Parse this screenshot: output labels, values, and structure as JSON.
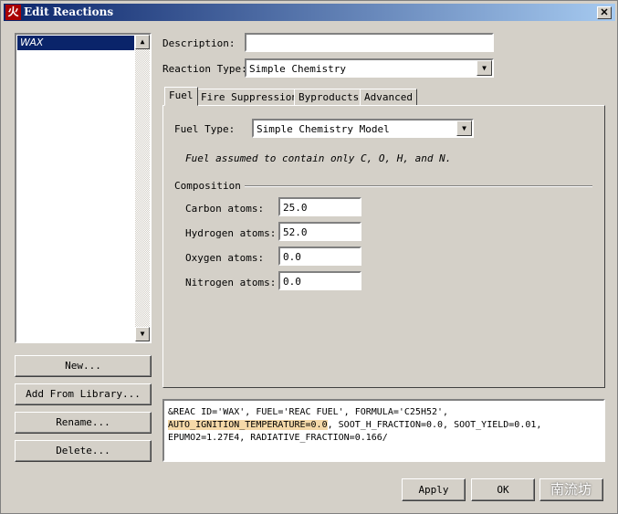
{
  "window": {
    "title": "Edit Reactions",
    "close": "✕",
    "app_icon": "火"
  },
  "reactions": {
    "items": [
      "WAX"
    ],
    "selected": "WAX"
  },
  "left_buttons": {
    "new": "New...",
    "add_library": "Add From Library...",
    "rename": "Rename...",
    "delete": "Delete..."
  },
  "form": {
    "description_label": "Description:",
    "description_value": "",
    "reaction_type_label": "Reaction Type:",
    "reaction_type_value": "Simple Chemistry"
  },
  "tabs": [
    "Fuel",
    "Fire Suppression",
    "Byproducts",
    "Advanced"
  ],
  "fuel": {
    "fuel_type_label": "Fuel Type:",
    "fuel_type_value": "Simple Chemistry Model",
    "note": "Fuel assumed to contain only C, O, H, and N.",
    "composition_label": "Composition",
    "fields": [
      {
        "label": "Carbon atoms:",
        "value": "25.0"
      },
      {
        "label": "Hydrogen atoms:",
        "value": "52.0"
      },
      {
        "label": "Oxygen atoms:",
        "value": "0.0"
      },
      {
        "label": "Nitrogen atoms:",
        "value": "0.0"
      }
    ]
  },
  "preview": {
    "line1": "&REAC ID='WAX', FUEL='REAC FUEL', FORMULA='C25H52',",
    "line2_highlight": "AUTO_IGNITION_TEMPERATURE=0.0",
    "line2_rest": ", SOOT_H_FRACTION=0.0, SOOT_YIELD=0.01,",
    "line3": "EPUMO2=1.27E4, RADIATIVE_FRACTION=0.166/"
  },
  "buttons": {
    "apply": "Apply",
    "ok": "OK"
  },
  "watermark": "南流坊"
}
